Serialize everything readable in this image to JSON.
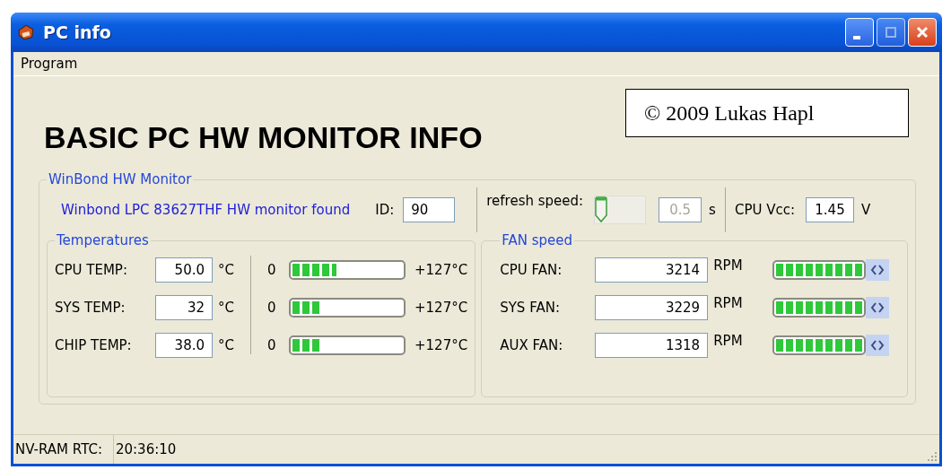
{
  "window": {
    "title": "PC info"
  },
  "menu": [
    "Program"
  ],
  "credit": "© 2009 Lukas Hapl",
  "heading": "BASIC PC HW MONITOR INFO",
  "monitor_group": {
    "title": "WinBond HW Monitor",
    "status": "Winbond LPC 83627THF HW monitor found",
    "id_label": "ID:",
    "id_value": "90",
    "refresh_label": "refresh speed:",
    "refresh_slider": {
      "level": 0
    },
    "refresh_value": "0.5",
    "refresh_disabled": true,
    "refresh_unit": "s",
    "vcc_label": "CPU Vcc:",
    "vcc_value": "1.45",
    "vcc_unit": "V"
  },
  "temperatures": {
    "title": "Temperatures",
    "rows": [
      {
        "label": "CPU TEMP:",
        "value": "50.0",
        "unit": "°C",
        "min": "0",
        "max": "+127°C",
        "level": 0.4
      },
      {
        "label": "SYS TEMP:",
        "value": "32",
        "unit": "°C",
        "min": "0",
        "max": "+127°C",
        "level": 0.25
      },
      {
        "label": "CHIP TEMP:",
        "value": "38.0",
        "unit": "°C",
        "min": "0",
        "max": "+127°C",
        "level": 0.25
      }
    ]
  },
  "fans": {
    "title": "FAN speed",
    "rows": [
      {
        "label": "CPU FAN:",
        "value": "3214",
        "unit": "RPM",
        "level": 1
      },
      {
        "label": "SYS FAN:",
        "value": "3229",
        "unit": "RPM",
        "level": 1
      },
      {
        "label": "AUX FAN:",
        "value": "1318",
        "unit": "RPM",
        "level": 1
      }
    ]
  },
  "status_bar": [
    "NV-RAM RTC:",
    "20:36:10"
  ]
}
